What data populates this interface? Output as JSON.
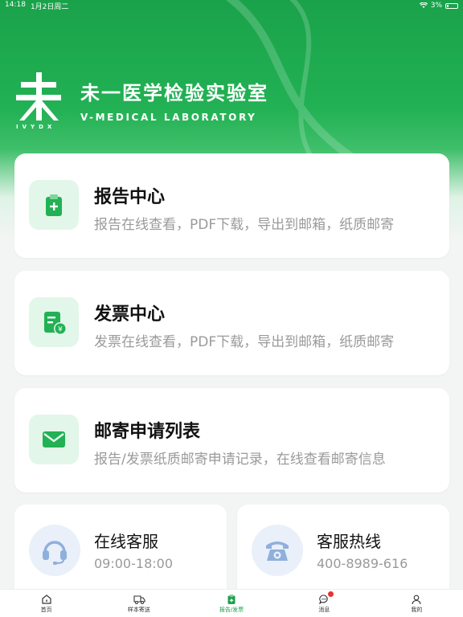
{
  "status_bar": {
    "time": "14:18",
    "date": "1月2日周二",
    "battery": "3%"
  },
  "brand": {
    "name_cn": "未一医学检验实验室",
    "name_en": "V-MEDICAL LABORATORY",
    "logo_sub": "IVYDX"
  },
  "cards": [
    {
      "title": "报告中心",
      "desc": "报告在线查看，PDF下载，导出到邮箱，纸质邮寄",
      "icon": "clipboard-plus-icon"
    },
    {
      "title": "发票中心",
      "desc": "发票在线查看，PDF下载，导出到邮箱，纸质邮寄",
      "icon": "invoice-yen-icon"
    },
    {
      "title": "邮寄申请列表",
      "desc": "报告/发票纸质邮寄申请记录，在线查看邮寄信息",
      "icon": "envelope-icon"
    }
  ],
  "service": {
    "online": {
      "title": "在线客服",
      "hours": "09:00-18:00",
      "icon": "headset-icon"
    },
    "hotline": {
      "title": "客服热线",
      "phone": "400-8989-616",
      "icon": "telephone-icon"
    }
  },
  "tabs": [
    {
      "label": "首页",
      "icon": "home-icon"
    },
    {
      "label": "样本寄送",
      "icon": "delivery-truck-icon"
    },
    {
      "label": "报告/发票",
      "icon": "report-icon",
      "active": true
    },
    {
      "label": "消息",
      "icon": "message-icon",
      "badge": true
    },
    {
      "label": "我的",
      "icon": "user-icon"
    }
  ],
  "colors": {
    "brand_green": "#1aa24a",
    "card_icon_bg": "#e3f6ea",
    "badge_red": "#e8322e"
  }
}
